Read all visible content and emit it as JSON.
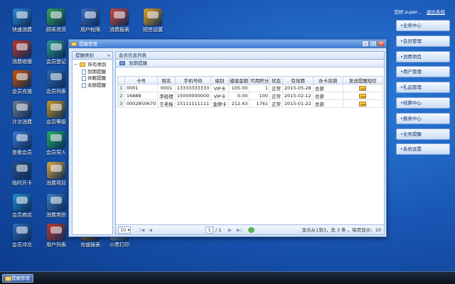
{
  "desktop": {
    "icons": [
      {
        "label": "快速消费",
        "color": "#2b8fd8",
        "col": 0,
        "row": 0
      },
      {
        "label": "顾客退货",
        "color": "#34a853",
        "col": 1,
        "row": 0
      },
      {
        "label": "用户权限",
        "color": "#3f6fc2",
        "col": 2,
        "row": 0
      },
      {
        "label": "消费报表",
        "color": "#d24a3a",
        "col": 3,
        "row": 0
      },
      {
        "label": "短信设置",
        "color": "#e3a21a",
        "col": 4,
        "row": 0
      },
      {
        "label": "消费收银",
        "color": "#c0392b",
        "col": 0,
        "row": 1
      },
      {
        "label": "会员登记",
        "color": "#2a9d8f",
        "col": 1,
        "row": 1
      },
      {
        "label": "会员充值",
        "color": "#d35400",
        "col": 0,
        "row": 2
      },
      {
        "label": "会员列表",
        "color": "#2b6cb0",
        "col": 1,
        "row": 2
      },
      {
        "label": "计次消费",
        "color": "#6b7c93",
        "col": 0,
        "row": 3
      },
      {
        "label": "会员等级",
        "color": "#c79a1d",
        "col": 1,
        "row": 3
      },
      {
        "label": "查看会员",
        "color": "#3a7bd5",
        "col": 0,
        "row": 4
      },
      {
        "label": "会员导入",
        "color": "#27ae60",
        "col": 1,
        "row": 4
      },
      {
        "label": "临时开卡",
        "color": "#2c5282",
        "col": 0,
        "row": 5
      },
      {
        "label": "消费项目",
        "color": "#e0a43a",
        "col": 1,
        "row": 5
      },
      {
        "label": "会员商店",
        "color": "#1f8fd0",
        "col": 0,
        "row": 6
      },
      {
        "label": "消费类别",
        "color": "#3b82c4",
        "col": 1,
        "row": 6
      },
      {
        "label": "会员冲次",
        "color": "#2d6fb8",
        "col": 0,
        "row": 7
      },
      {
        "label": "用户列表",
        "color": "#c0392b",
        "col": 1,
        "row": 7
      },
      {
        "label": "充值报表",
        "color": "#b7791f",
        "col": 2,
        "row": 7
      },
      {
        "label": "小票打印",
        "color": "#a0aec0",
        "col": 3,
        "row": 7
      }
    ]
  },
  "header": {
    "greeting": "您好,super ,",
    "logout": "退出系统"
  },
  "right_menu": [
    "•业务中心",
    "•会员管理",
    "•消费项目",
    "•用户管理",
    "•礼品管理",
    "•结算中心",
    "•报表中心",
    "•业务提醒",
    "•系统设置"
  ],
  "window": {
    "title": "提醒管理",
    "left_pane": {
      "header": "提醒类别",
      "collapse": "«",
      "root": "所有类别",
      "children": [
        "到期提醒",
        "休眠提醒",
        "余额提醒"
      ]
    },
    "right_pane": {
      "header": "会员信息列表",
      "sub_tab": "到期提醒",
      "columns": [
        "卡号",
        "姓名",
        "手机号码",
        "级别",
        "储值金额",
        "可用积分",
        "状态",
        "有效期",
        "办卡店铺",
        "发送提醒短信"
      ],
      "rows": [
        {
          "n": "1",
          "card": "0001",
          "name": "0001",
          "phone": "13333333333",
          "level": "VIP卡",
          "balance": "105.00",
          "points": "1",
          "status": "正常",
          "expiry": "2015-05-28",
          "shop": "总部"
        },
        {
          "n": "2",
          "card": "16888",
          "name": "李经理",
          "phone": "15000000000",
          "level": "VIP卡",
          "balance": "0.00",
          "points": "100",
          "status": "正常",
          "expiry": "2015-02-12",
          "shop": "总部"
        },
        {
          "n": "3",
          "card": "0002850670",
          "name": "王老板",
          "phone": "15111111111",
          "level": "金牌卡",
          "balance": "212.43",
          "points": "1761",
          "status": "正常",
          "expiry": "2015-01-22",
          "shop": "总部"
        }
      ]
    },
    "pager": {
      "page_size": "10 ▾",
      "first": "|◀",
      "prev": "◀",
      "page": "1",
      "total_pages": "/ 1",
      "next": "▶",
      "last": "▶|",
      "info": "显示从1到3，总 3 条 。每页显示：10"
    }
  },
  "taskbar": {
    "task": "提醒管理"
  }
}
